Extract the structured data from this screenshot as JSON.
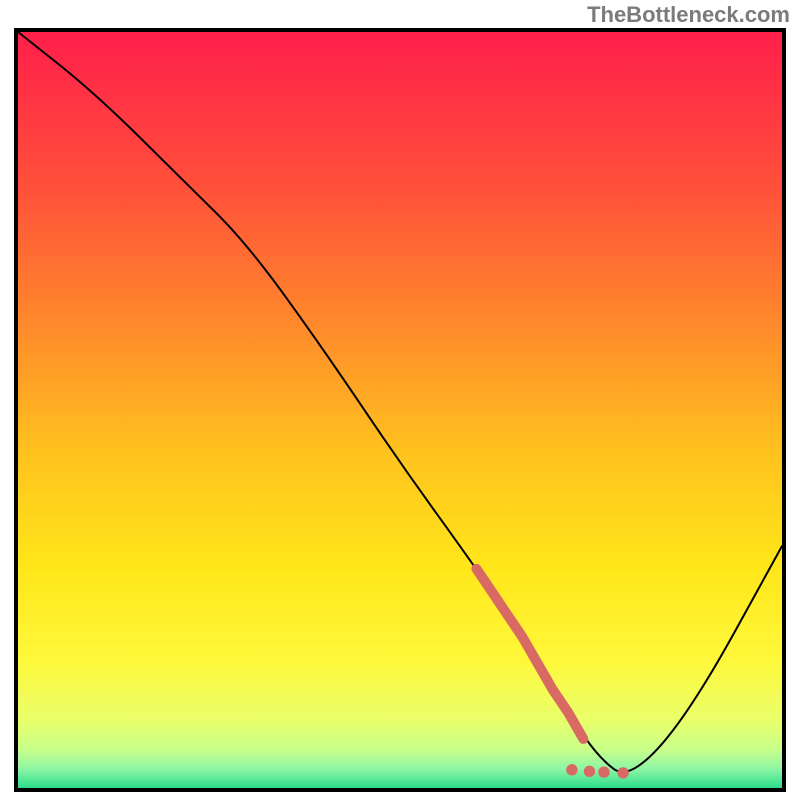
{
  "attribution": "TheBottleneck.com",
  "chart_data": {
    "type": "line",
    "title": "",
    "xlabel": "",
    "ylabel": "",
    "xlim": [
      0,
      100
    ],
    "ylim": [
      0,
      100
    ],
    "grid": false,
    "legend": false,
    "gradient_stops": [
      {
        "pos": 0.0,
        "color": "#ff1f4b"
      },
      {
        "pos": 0.2,
        "color": "#ff4f3a"
      },
      {
        "pos": 0.4,
        "color": "#ff8f2a"
      },
      {
        "pos": 0.55,
        "color": "#ffc21e"
      },
      {
        "pos": 0.7,
        "color": "#ffe61a"
      },
      {
        "pos": 0.82,
        "color": "#fff83a"
      },
      {
        "pos": 0.9,
        "color": "#eaff6a"
      },
      {
        "pos": 0.94,
        "color": "#c7ff8a"
      },
      {
        "pos": 0.965,
        "color": "#8cf5a5"
      },
      {
        "pos": 0.985,
        "color": "#3ce28e"
      },
      {
        "pos": 1.0,
        "color": "#18c471"
      }
    ],
    "series": [
      {
        "name": "bottleneck-curve",
        "color": "#000000",
        "width": 2,
        "x": [
          0,
          10,
          22,
          30,
          40,
          50,
          60,
          66,
          72,
          76,
          80,
          88,
          100
        ],
        "y": [
          100,
          92,
          80,
          72,
          58,
          43,
          29,
          20,
          10,
          4,
          1,
          10,
          32
        ]
      }
    ],
    "highlight_segment": {
      "name": "highlight-dots",
      "color": "#d86a63",
      "width": 10,
      "from_index_on_series": 0,
      "points_x": [
        60,
        62,
        64,
        66,
        68,
        70,
        72,
        74,
        75.5,
        77.5,
        80
      ],
      "points_y": [
        29,
        26,
        23,
        20,
        16.5,
        13,
        10,
        6.5,
        4.5,
        3.0,
        2.3
      ],
      "tail_dots_x": [
        72.5,
        74.8,
        76.7,
        79.2
      ],
      "tail_dots_y": [
        2.4,
        2.2,
        2.1,
        2.0
      ]
    }
  }
}
